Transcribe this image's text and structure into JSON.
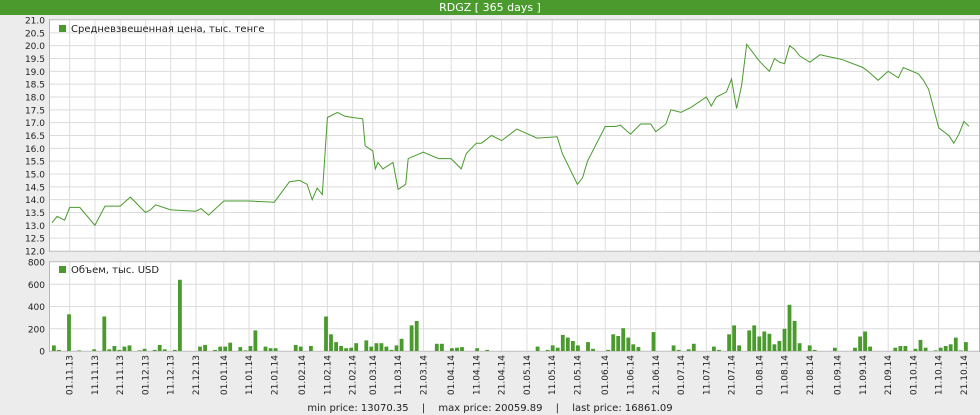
{
  "header": {
    "title": "RDGZ [ 365 days ]"
  },
  "colors": {
    "accent": "#4a9a2e",
    "grid": "#dcdcdc",
    "line": "#4a9a2e"
  },
  "footer": {
    "min_label": "min price: 13070.35",
    "max_label": "max price: 20059.89",
    "last_label": "last price: 16861.09",
    "separator": "|"
  },
  "chart_data": [
    {
      "type": "line",
      "legend": "Средневзвешенная цена, тыс. тенге",
      "ylim": [
        12.0,
        21.0
      ],
      "yticks": [
        "12.0",
        "12.5",
        "13.0",
        "13.5",
        "14.0",
        "14.5",
        "15.0",
        "15.5",
        "16.0",
        "16.5",
        "17.0",
        "17.5",
        "18.0",
        "18.5",
        "19.0",
        "19.5",
        "20.0",
        "20.5",
        "21.0"
      ],
      "grid": true,
      "series": [
        {
          "x": [
            "25.10.13",
            "27.10.13",
            "30.10.13",
            "01.11.13",
            "05.11.13",
            "11.11.13",
            "15.11.13",
            "21.11.13",
            "25.11.13",
            "01.12.13",
            "03.12.13",
            "05.12.13",
            "11.12.13",
            "21.12.13",
            "23.12.13",
            "26.12.13",
            "01.01.14",
            "05.01.14",
            "09.01.14",
            "11.01.14",
            "21.01.14",
            "27.01.14",
            "31.01.14",
            "01.02.14",
            "03.02.14",
            "05.02.14",
            "07.02.14",
            "09.02.14",
            "11.02.14",
            "13.02.14",
            "15.02.14",
            "18.02.14",
            "21.02.14",
            "25.02.14",
            "26.02.14",
            "01.03.14",
            "02.03.14",
            "03.03.14",
            "05.03.14",
            "09.03.14",
            "11.03.14",
            "14.03.14",
            "15.03.14",
            "21.03.14",
            "27.03.14",
            "01.04.14",
            "05.04.14",
            "07.04.14",
            "11.04.14",
            "13.04.14",
            "17.04.14",
            "21.04.14",
            "27.04.14",
            "05.05.14",
            "13.05.14",
            "15.05.14",
            "21.05.14",
            "23.05.14",
            "25.05.14",
            "01.06.14",
            "05.06.14",
            "07.06.14",
            "11.06.14",
            "15.06.14",
            "19.06.14",
            "21.06.14",
            "25.06.14",
            "27.06.14",
            "01.07.14",
            "05.07.14",
            "11.07.14",
            "13.07.14",
            "15.07.14",
            "19.07.14",
            "21.07.14",
            "23.07.14",
            "25.07.14",
            "27.07.14",
            "01.08.14",
            "05.08.14",
            "07.08.14",
            "09.08.14",
            "11.08.14",
            "13.08.14",
            "15.08.14",
            "17.08.14",
            "21.08.14",
            "25.08.14",
            "27.08.14",
            "01.09.14",
            "03.09.14",
            "11.09.14",
            "13.09.14",
            "17.09.14",
            "21.09.14",
            "25.09.14",
            "27.09.14",
            "03.10.14",
            "05.10.14",
            "07.10.14",
            "11.10.14",
            "15.10.14",
            "17.10.14",
            "19.10.14",
            "21.10.14",
            "23.10.14"
          ],
          "values": [
            13.1,
            13.35,
            13.2,
            13.7,
            13.7,
            13.0,
            13.75,
            13.75,
            14.1,
            13.5,
            13.6,
            13.8,
            13.6,
            13.55,
            13.65,
            13.4,
            13.95,
            13.95,
            13.95,
            13.95,
            13.9,
            14.7,
            14.75,
            14.7,
            14.6,
            14.0,
            14.45,
            14.2,
            17.2,
            17.3,
            17.4,
            17.25,
            17.2,
            17.15,
            16.1,
            15.9,
            15.2,
            15.45,
            15.2,
            15.45,
            14.4,
            14.6,
            15.6,
            15.85,
            15.6,
            15.6,
            15.2,
            15.8,
            16.2,
            16.2,
            16.5,
            16.3,
            16.75,
            16.4,
            16.45,
            15.8,
            14.6,
            14.85,
            15.5,
            16.85,
            16.85,
            16.9,
            16.55,
            16.95,
            16.95,
            16.65,
            16.95,
            17.5,
            17.4,
            17.6,
            18.0,
            17.65,
            18.0,
            18.2,
            18.7,
            17.55,
            18.45,
            20.05,
            19.4,
            19.0,
            19.5,
            19.35,
            19.3,
            20.0,
            19.85,
            19.6,
            19.35,
            19.65,
            19.6,
            19.5,
            19.45,
            19.15,
            19.0,
            18.65,
            19.0,
            18.75,
            19.15,
            18.9,
            18.65,
            18.3,
            16.8,
            16.5,
            16.2,
            16.55,
            17.05,
            16.86
          ]
        }
      ]
    },
    {
      "type": "bar",
      "legend": "Объем, тыс. USD",
      "ylim": [
        0,
        800
      ],
      "yticks": [
        "0",
        "200",
        "400",
        "600",
        "800"
      ],
      "grid": true,
      "xticks": [
        "01.11.13",
        "11.11.13",
        "21.11.13",
        "01.12.13",
        "11.12.13",
        "21.12.13",
        "01.01.14",
        "11.01.14",
        "21.01.14",
        "01.02.14",
        "11.02.14",
        "21.02.14",
        "01.03.14",
        "11.03.14",
        "21.03.14",
        "01.04.14",
        "11.04.14",
        "21.04.14",
        "01.05.14",
        "11.05.14",
        "21.05.14",
        "01.06.14",
        "11.06.14",
        "21.06.14",
        "01.07.14",
        "11.07.14",
        "21.07.14",
        "01.08.14",
        "11.08.14",
        "21.08.14",
        "01.09.14",
        "11.09.14",
        "21.09.14",
        "01.10.14",
        "11.10.14",
        "21.10.14"
      ],
      "values": [
        50,
        10,
        0,
        330,
        0,
        5,
        0,
        0,
        15,
        0,
        310,
        15,
        45,
        10,
        40,
        50,
        0,
        5,
        20,
        0,
        10,
        55,
        15,
        0,
        10,
        640,
        0,
        0,
        0,
        40,
        55,
        0,
        10,
        40,
        40,
        75,
        0,
        35,
        5,
        45,
        185,
        0,
        40,
        25,
        25,
        0,
        0,
        0,
        55,
        40,
        0,
        45,
        0,
        0,
        310,
        150,
        80,
        45,
        25,
        30,
        70,
        0,
        95,
        40,
        70,
        70,
        40,
        10,
        50,
        110,
        0,
        230,
        270,
        0,
        0,
        0,
        65,
        65,
        0,
        25,
        30,
        35,
        0,
        0,
        25,
        0,
        10,
        0,
        0,
        0,
        0,
        0,
        0,
        0,
        0,
        0,
        40,
        0,
        10,
        50,
        30,
        145,
        120,
        90,
        50,
        0,
        80,
        20,
        0,
        0,
        10,
        150,
        135,
        205,
        120,
        60,
        35,
        0,
        0,
        170,
        0,
        0,
        0,
        50,
        10,
        0,
        15,
        65,
        0,
        0,
        0,
        40,
        10,
        0,
        150,
        230,
        50,
        0,
        185,
        230,
        130,
        175,
        155,
        60,
        90,
        200,
        415,
        270,
        70,
        0,
        50,
        10,
        0,
        0,
        0,
        30,
        0,
        0,
        0,
        30,
        130,
        175,
        40,
        0,
        0,
        0,
        0,
        30,
        45,
        45,
        0,
        20,
        100,
        30,
        0,
        5,
        30,
        45,
        60,
        120,
        5,
        80
      ]
    }
  ]
}
